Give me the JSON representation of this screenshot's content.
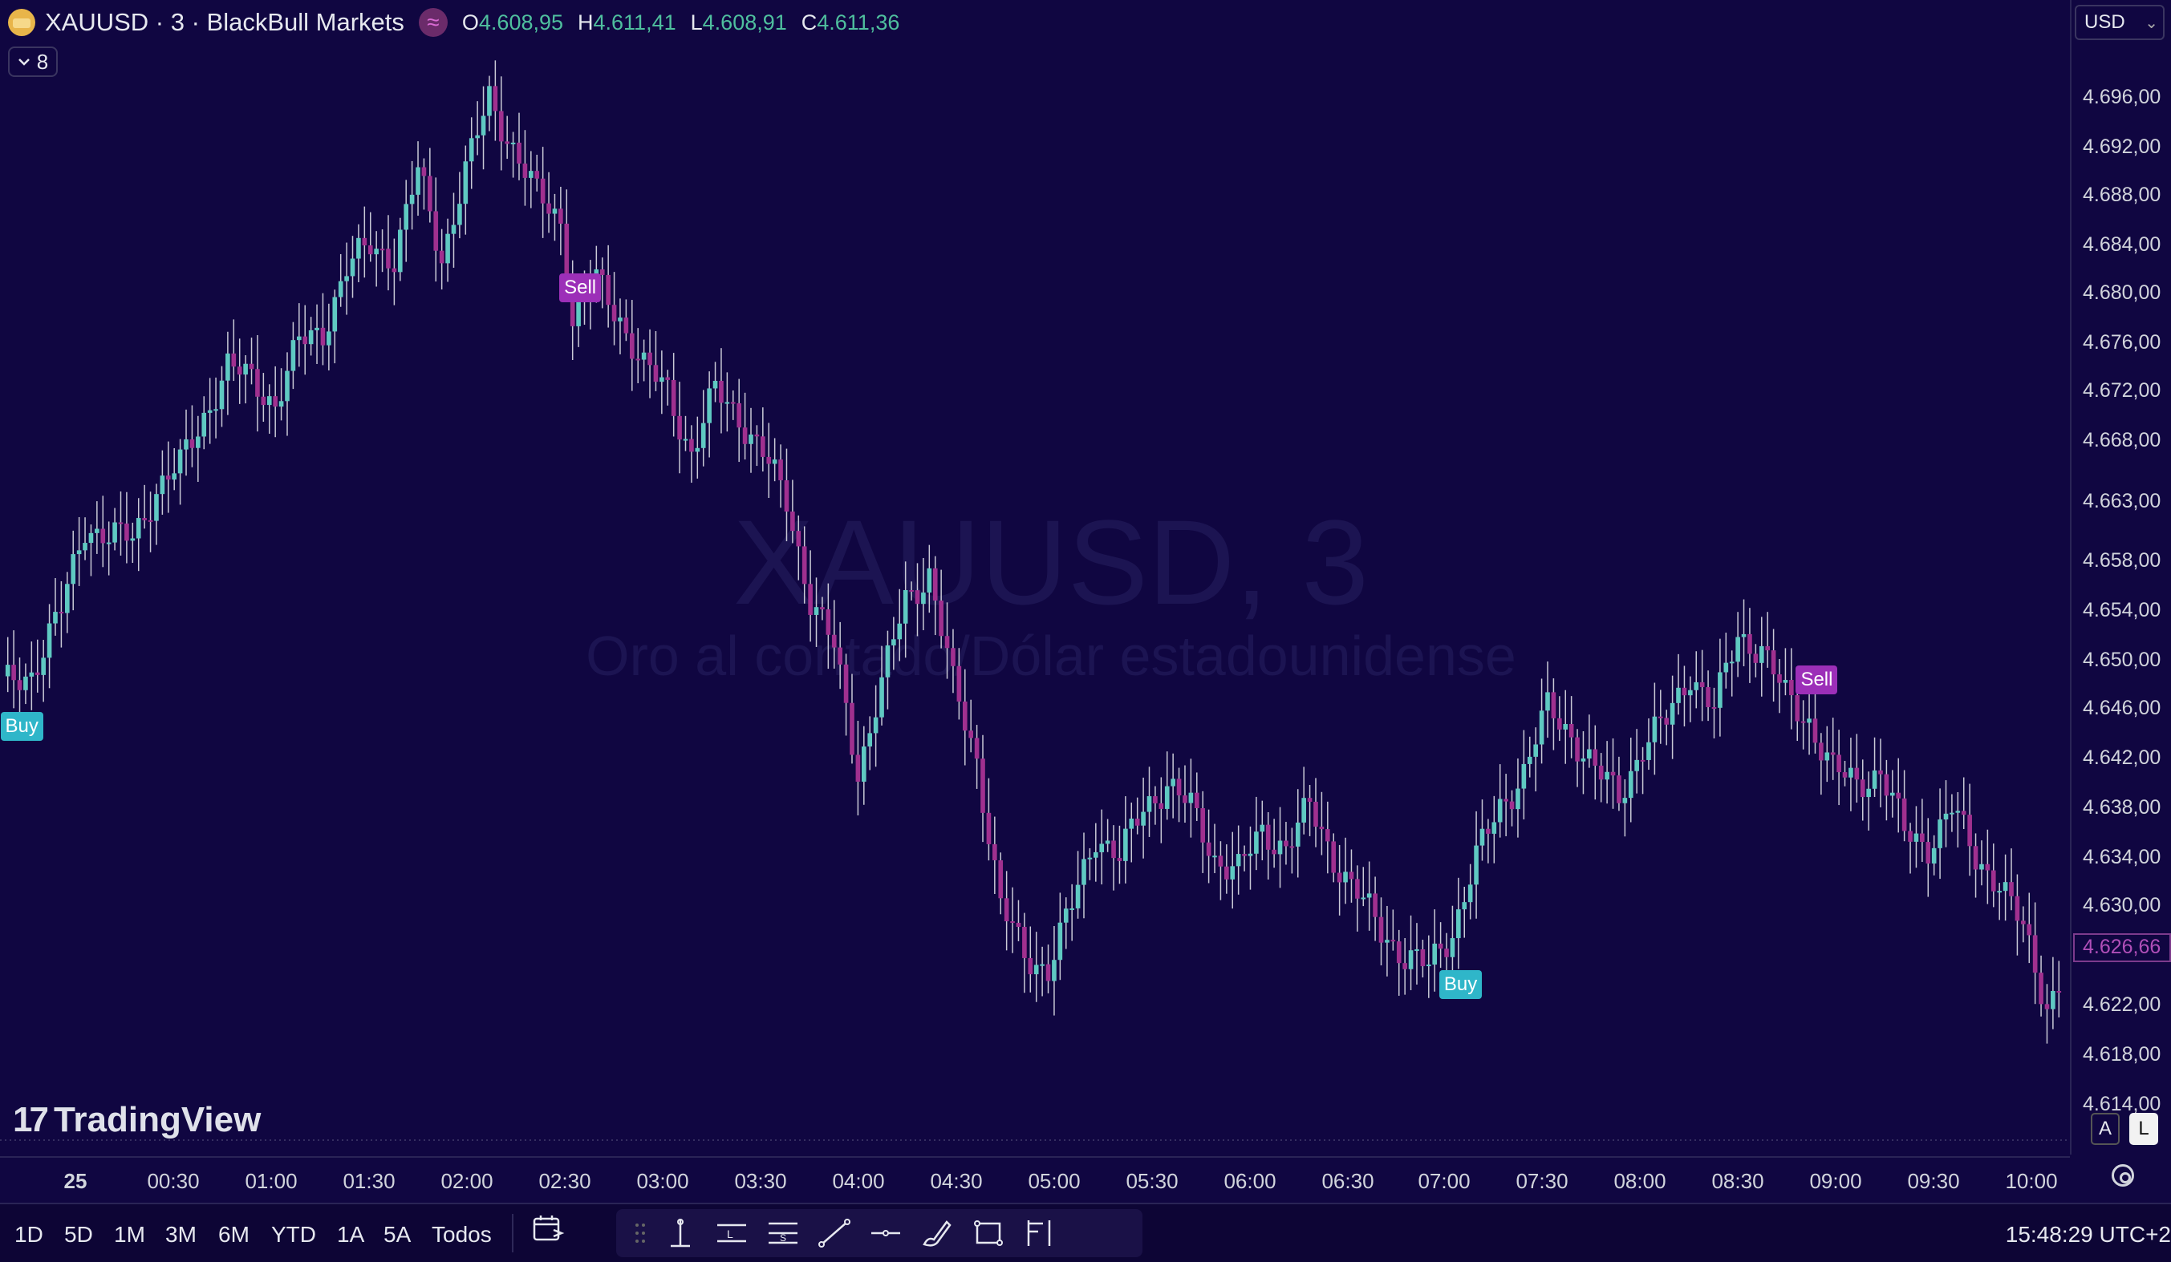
{
  "header": {
    "symbol_title": "XAUUSD · 3 · BlackBull Markets",
    "indicator_glyph": "≈",
    "ohlc": [
      {
        "key": "O",
        "value": "4.608,95"
      },
      {
        "key": "H",
        "value": "4.611,41"
      },
      {
        "key": "L",
        "value": "4.608,91"
      },
      {
        "key": "C",
        "value": "4.611,36"
      }
    ],
    "legend_count": "8"
  },
  "watermark": {
    "line1": "XAUUSD, 3",
    "line2": "Oro al contado/Dólar estadounidense"
  },
  "brand": {
    "mark": "17",
    "name": "TradingView"
  },
  "price_scale": {
    "currency": "USD",
    "current_price": "4.626,66",
    "scale_a": "A",
    "scale_l": "L"
  },
  "bottom_bar": {
    "ranges": [
      "1D",
      "5D",
      "1M",
      "3M",
      "6M",
      "YTD",
      "1A",
      "5A",
      "Todos"
    ],
    "clock": "15:48:29 UTC+2"
  },
  "chart_data": {
    "type": "candlestick",
    "y_ticks": [
      4696,
      4692,
      4688,
      4684,
      4680,
      4676,
      4672,
      4668,
      4663,
      4658,
      4654,
      4650,
      4646,
      4642,
      4638,
      4634,
      4630,
      4622,
      4618,
      4614
    ],
    "y_tick_labels": [
      "4.696,00",
      "4.692,00",
      "4.688,00",
      "4.684,00",
      "4.680,00",
      "4.676,00",
      "4.672,00",
      "4.668,00",
      "4.663,00",
      "4.658,00",
      "4.654,00",
      "4.650,00",
      "4.646,00",
      "4.642,00",
      "4.638,00",
      "4.634,00",
      "4.630,00",
      "4.622,00",
      "4.618,00",
      "4.614,00"
    ],
    "x_ticks": [
      "25",
      "00:30",
      "01:00",
      "01:30",
      "02:00",
      "02:30",
      "03:00",
      "03:30",
      "04:00",
      "04:30",
      "05:00",
      "05:30",
      "06:00",
      "06:30",
      "07:00",
      "07:30",
      "08:00",
      "08:30",
      "09:00",
      "09:30",
      "10:00"
    ],
    "up_color": "#5fc9c2",
    "down_color": "#a0308f",
    "close_path": [
      [
        0,
        4648
      ],
      [
        5,
        4649
      ],
      [
        10,
        4654
      ],
      [
        14,
        4661
      ],
      [
        18,
        4660
      ],
      [
        22,
        4660
      ],
      [
        26,
        4664
      ],
      [
        30,
        4666
      ],
      [
        34,
        4670
      ],
      [
        38,
        4674
      ],
      [
        42,
        4673
      ],
      [
        46,
        4671
      ],
      [
        50,
        4676
      ],
      [
        54,
        4677
      ],
      [
        58,
        4682
      ],
      [
        62,
        4684
      ],
      [
        66,
        4683
      ],
      [
        70,
        4690
      ],
      [
        74,
        4683
      ],
      [
        78,
        4690
      ],
      [
        82,
        4696
      ],
      [
        86,
        4692
      ],
      [
        90,
        4688
      ],
      [
        94,
        4686
      ],
      [
        96,
        4678
      ],
      [
        100,
        4681
      ],
      [
        104,
        4678
      ],
      [
        108,
        4674
      ],
      [
        112,
        4672
      ],
      [
        116,
        4667
      ],
      [
        120,
        4672
      ],
      [
        124,
        4670
      ],
      [
        128,
        4667
      ],
      [
        132,
        4663
      ],
      [
        136,
        4655
      ],
      [
        140,
        4651
      ],
      [
        144,
        4641
      ],
      [
        148,
        4648
      ],
      [
        152,
        4655
      ],
      [
        156,
        4657
      ],
      [
        160,
        4648
      ],
      [
        164,
        4642
      ],
      [
        168,
        4630
      ],
      [
        172,
        4626
      ],
      [
        176,
        4625
      ],
      [
        180,
        4630
      ],
      [
        184,
        4636
      ],
      [
        188,
        4634
      ],
      [
        192,
        4638
      ],
      [
        196,
        4640
      ],
      [
        200,
        4638
      ],
      [
        204,
        4634
      ],
      [
        208,
        4633
      ],
      [
        212,
        4636
      ],
      [
        216,
        4635
      ],
      [
        220,
        4638
      ],
      [
        224,
        4634
      ],
      [
        228,
        4631
      ],
      [
        232,
        4628
      ],
      [
        236,
        4626
      ],
      [
        240,
        4625
      ],
      [
        244,
        4628
      ],
      [
        248,
        4634
      ],
      [
        252,
        4638
      ],
      [
        256,
        4641
      ],
      [
        260,
        4646
      ],
      [
        264,
        4644
      ],
      [
        268,
        4641
      ],
      [
        272,
        4639
      ],
      [
        276,
        4643
      ],
      [
        280,
        4645
      ],
      [
        284,
        4649
      ],
      [
        288,
        4646
      ],
      [
        292,
        4652
      ],
      [
        296,
        4651
      ],
      [
        300,
        4647
      ],
      [
        304,
        4645
      ],
      [
        308,
        4641
      ],
      [
        312,
        4640
      ],
      [
        316,
        4641
      ],
      [
        320,
        4636
      ],
      [
        324,
        4635
      ],
      [
        328,
        4638
      ],
      [
        332,
        4634
      ],
      [
        336,
        4632
      ],
      [
        340,
        4628
      ],
      [
        344,
        4622
      ],
      [
        346,
        4624
      ]
    ],
    "signals": [
      {
        "label": "Buy",
        "bar": 2,
        "kind": "buy"
      },
      {
        "label": "Sell",
        "bar": 96,
        "kind": "sell"
      },
      {
        "label": "Buy",
        "bar": 244,
        "kind": "buy"
      },
      {
        "label": "Sell",
        "bar": 304,
        "kind": "sell"
      }
    ],
    "total_bars": 346,
    "ylim": [
      4612,
      4700
    ]
  }
}
